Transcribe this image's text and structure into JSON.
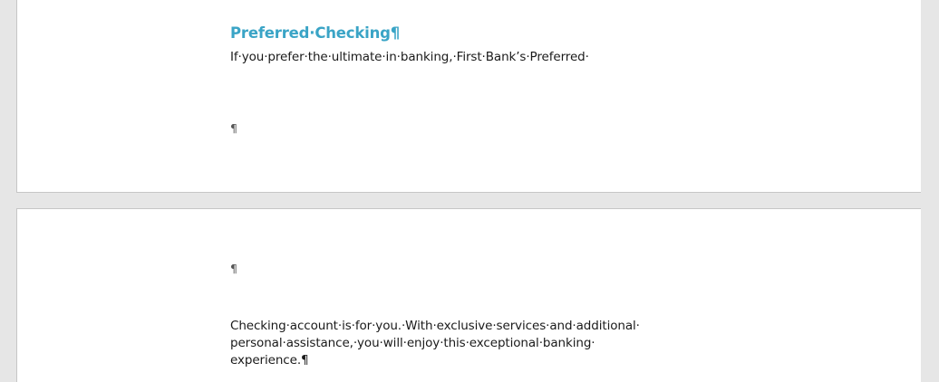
{
  "document": {
    "page1": {
      "heading": "Preferred·Checking",
      "heading_mark": "¶",
      "line1": "If·you·prefer·the·ultimate·in·banking,·First·Bank’s·Preferred·",
      "empty_paragraph_mark": "¶"
    },
    "page2": {
      "empty_paragraph_mark": "¶",
      "line1": "Checking·account·is·for·you.·With·exclusive·services·and·additional·",
      "line2": "personal·assistance,·you·will·enjoy·this·exceptional·banking·",
      "line3": "experience.¶"
    }
  },
  "colors": {
    "heading": "#3aa4c6",
    "page_background": "#ffffff",
    "canvas_background": "#e6e6e6"
  }
}
